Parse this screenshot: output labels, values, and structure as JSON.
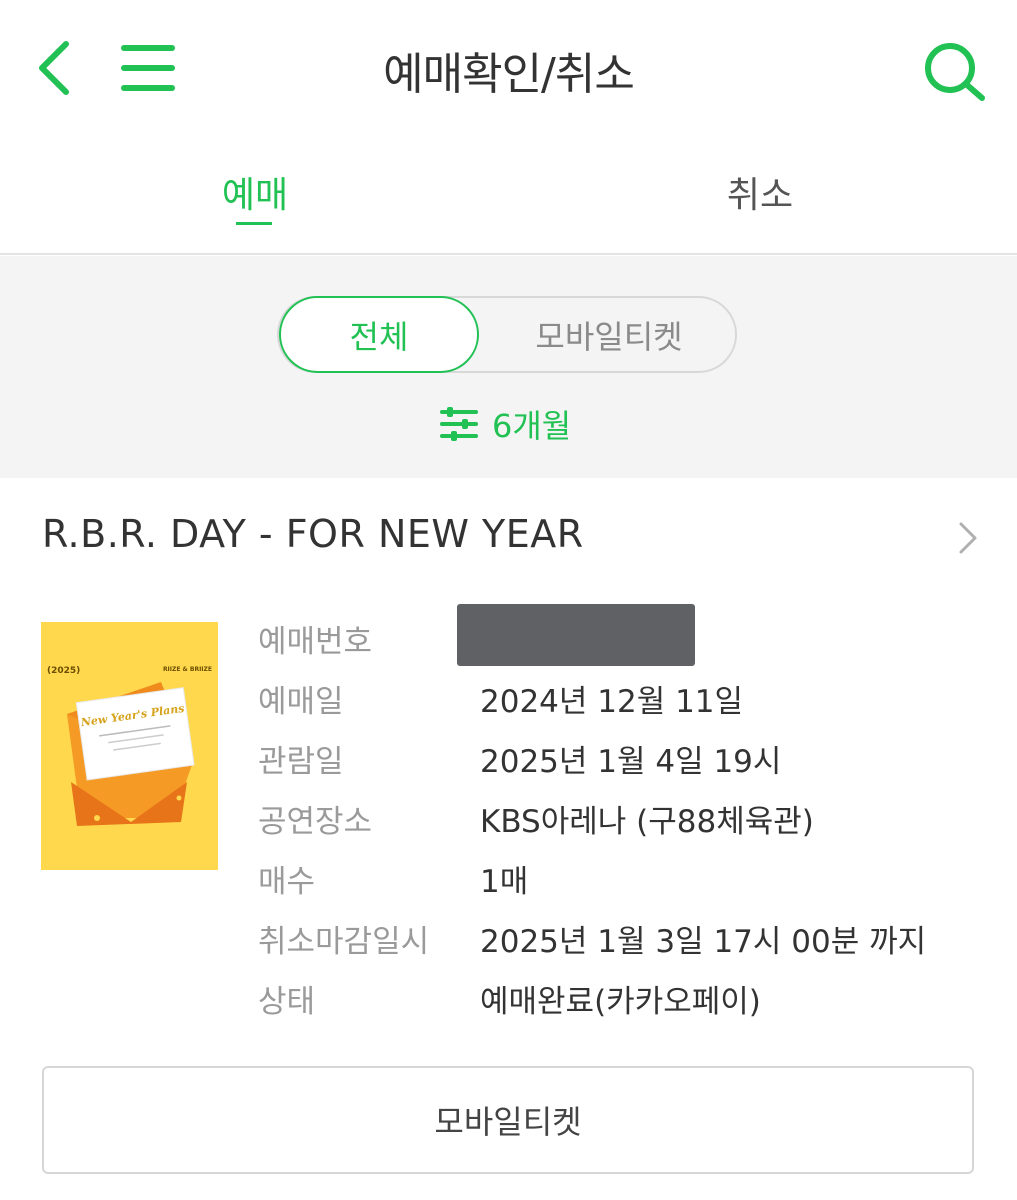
{
  "header": {
    "title": "예매확인/취소",
    "icons": {
      "back": "chevron-left-icon",
      "menu": "hamburger-menu-icon",
      "search": "search-icon"
    }
  },
  "tabs": [
    {
      "label": "예매",
      "selected": true
    },
    {
      "label": "취소",
      "selected": false
    }
  ],
  "filter": {
    "segments": [
      {
        "label": "전체",
        "selected": true
      },
      {
        "label": "모바일티켓",
        "selected": false
      }
    ],
    "period": {
      "label": "6개월",
      "icon": "filter-sliders-icon"
    }
  },
  "booking": {
    "event_title": "R.B.R. DAY - FOR NEW YEAR",
    "poster": {
      "year": "(2025)",
      "brand": "RIIZE & BRIIZE"
    },
    "details": [
      {
        "label": "예매번호",
        "value": ""
      },
      {
        "label": "예매일",
        "value": "2024년 12월 11일"
      },
      {
        "label": "관람일",
        "value": "2025년 1월 4일 19시"
      },
      {
        "label": "공연장소",
        "value": "KBS아레나 (구88체육관)"
      },
      {
        "label": "매수",
        "value": "1매"
      },
      {
        "label": "취소마감일시",
        "value": "2025년 1월 3일 17시 00분 까지"
      },
      {
        "label": "상태",
        "value": "예매완료(카카오페이)"
      }
    ],
    "mobile_ticket_button": "모바일티켓"
  },
  "colors": {
    "accent": "#21c154",
    "text": "#333333",
    "label": "#9a9a9a",
    "filter_bg": "#f4f4f4",
    "mask": "#5f6164",
    "poster": "#ffd84d"
  }
}
